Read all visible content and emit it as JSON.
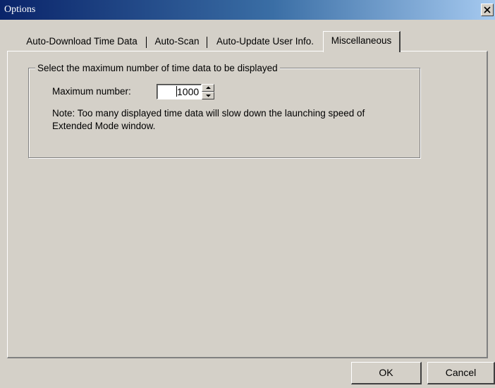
{
  "window": {
    "title": "Options"
  },
  "tabs": [
    {
      "label": "Auto-Download Time Data",
      "active": false
    },
    {
      "label": "Auto-Scan",
      "active": false
    },
    {
      "label": "Auto-Update User Info.",
      "active": false
    },
    {
      "label": "Miscellaneous",
      "active": true
    }
  ],
  "miscellaneous": {
    "group_title": "Select the maximum number of time data to be displayed",
    "max_number_label": "Maximum number:",
    "max_number_value": "1000",
    "note_line1": "Note: Too many displayed time data will slow down the launching speed of",
    "note_line2": "Extended Mode window."
  },
  "buttons": {
    "ok": "OK",
    "cancel": "Cancel"
  },
  "icons": {
    "close": "close-icon",
    "spin_up": "arrow-up-icon",
    "spin_down": "arrow-down-icon"
  },
  "colors": {
    "face": "#d4d0c8",
    "titlebar_start": "#0a246a",
    "titlebar_end": "#a6caf0",
    "title_text": "#ffffff"
  }
}
